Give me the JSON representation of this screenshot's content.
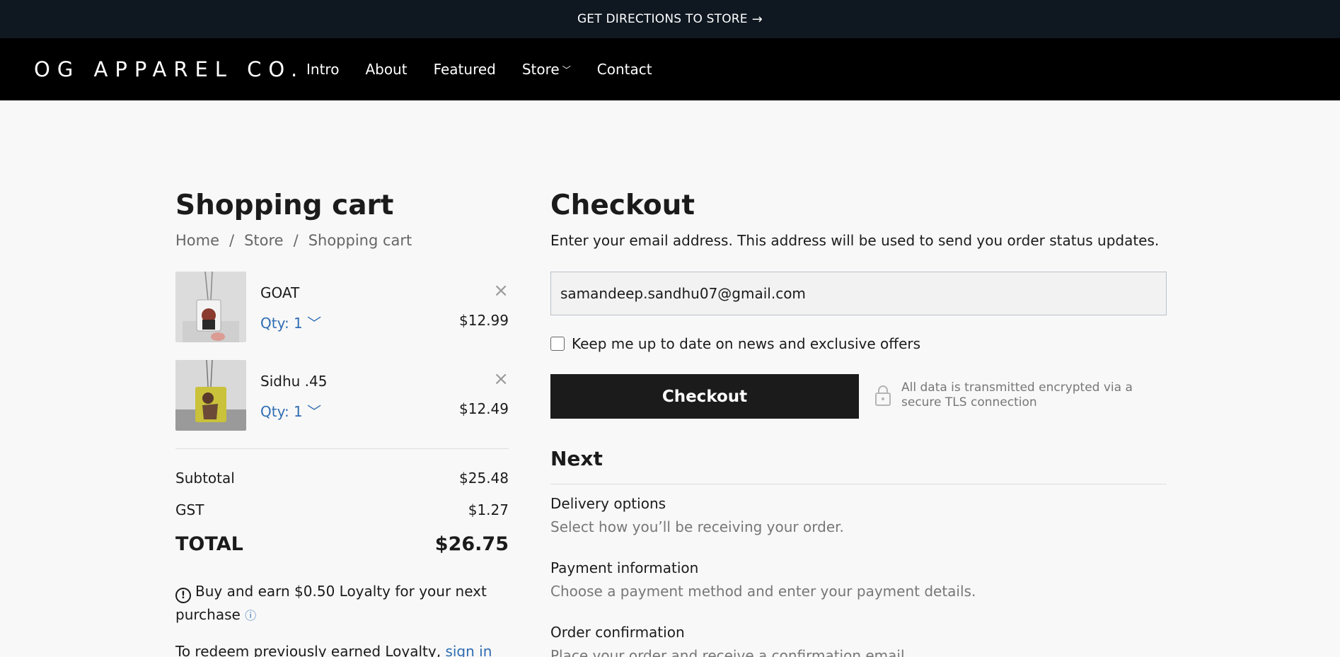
{
  "announcement": {
    "text": "GET DIRECTIONS TO STORE",
    "arrow": "→"
  },
  "nav": {
    "logo": "OG APPAREL CO.",
    "items": [
      {
        "label": "Intro"
      },
      {
        "label": "About"
      },
      {
        "label": "Featured"
      },
      {
        "label": "Store",
        "chevron": "﹀"
      },
      {
        "label": "Contact"
      }
    ]
  },
  "cart": {
    "title": "Shopping cart",
    "breadcrumb": [
      "Home",
      "Store",
      "Shopping cart"
    ],
    "breadcrumb_sep": "/",
    "items": [
      {
        "name": "GOAT",
        "qty": "Qty: 1",
        "price": "$12.99",
        "remove": "×"
      },
      {
        "name": "Sidhu .45",
        "qty": "Qty: 1",
        "price": "$12.49",
        "remove": "×"
      }
    ],
    "subtotal_label": "Subtotal",
    "subtotal": "$25.48",
    "gst_label": "GST",
    "gst": "$1.27",
    "total_label": "TOTAL",
    "total": "$26.75",
    "loyalty_text": "Buy and earn $0.50 Loyalty for your next purchase",
    "redeem_text": "To redeem previously earned Loyalty,",
    "redeem_link": "sign in"
  },
  "checkout": {
    "title": "Checkout",
    "description": "Enter your email address. This address will be used to send you order status updates.",
    "email_value": "samandeep.sandhu07@gmail.com",
    "optin_label": "Keep me up to date on news and exclusive offers",
    "button_label": "Checkout",
    "secure_text": "All data is transmitted encrypted via a secure TLS connection",
    "next_title": "Next",
    "steps": [
      {
        "title": "Delivery options",
        "desc": "Select how you’ll be receiving your order."
      },
      {
        "title": "Payment information",
        "desc": "Choose a payment method and enter your payment details."
      },
      {
        "title": "Order confirmation",
        "desc": "Place your order and receive a confirmation email."
      }
    ]
  }
}
